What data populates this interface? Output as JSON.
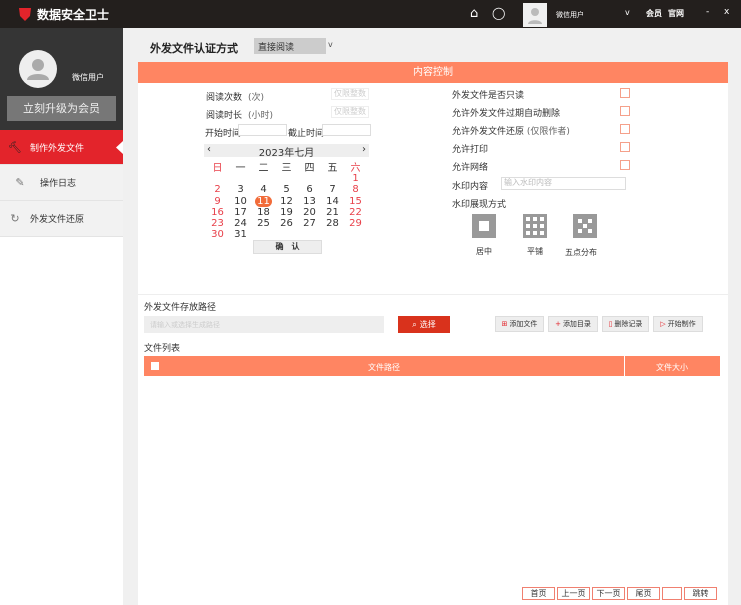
{
  "app": {
    "title": "数据安全卫士",
    "user": "微信用户",
    "member": "会员",
    "site": "官网",
    "minimize": "-",
    "close": "x",
    "dropdown": "v"
  },
  "sidebar": {
    "user": "微信用户",
    "upgrade": "立刻升级为会员",
    "items": [
      {
        "label": "制作外发文件",
        "icon": "wrench-icon"
      },
      {
        "label": "操作日志",
        "icon": "edit-icon"
      },
      {
        "label": "外发文件还原",
        "icon": "refresh-icon"
      }
    ]
  },
  "auth": {
    "label": "外发文件认证方式",
    "value": "直接阅读",
    "arrow": "v"
  },
  "content_control": {
    "title": "内容控制",
    "read_count": {
      "label": "阅读次数",
      "unit": "(次)",
      "placeholder": "仅限整数"
    },
    "read_duration": {
      "label": "阅读时长",
      "unit": "(小时)",
      "placeholder": "仅限整数"
    },
    "start_time": "开始时间",
    "end_time": "截止时间",
    "calendar": {
      "title": "2023年七月",
      "prev": "‹",
      "next": "›",
      "weekdays": [
        "日",
        "一",
        "二",
        "三",
        "四",
        "五",
        "六"
      ],
      "first_weekday": 6,
      "days": 31,
      "selected": 11,
      "confirm": "确　认"
    },
    "options": [
      {
        "label": "外发文件是否只读",
        "checked": false
      },
      {
        "label": "允许外发文件过期自动删除",
        "checked": false
      },
      {
        "label": "允许外发文件还原",
        "note": "(仅限作者)",
        "checked": false
      },
      {
        "label": "允许打印",
        "checked": false
      },
      {
        "label": "允许网络",
        "checked": false
      }
    ],
    "watermark": {
      "label": "水印内容",
      "placeholder": "输入水印内容",
      "mode_label": "水印展现方式",
      "modes": [
        "居中",
        "平铺",
        "五点分布"
      ]
    }
  },
  "path": {
    "label": "外发文件存放路径",
    "placeholder": "请输入或选择生成路径",
    "select": "选择"
  },
  "toolbar": {
    "add_file": "添加文件",
    "add_dir": "添加目录",
    "delete": "删除记录",
    "start": "开始制作"
  },
  "file_list": {
    "label": "文件列表",
    "columns": [
      "文件路径",
      "文件大小"
    ],
    "rows": []
  },
  "pager": {
    "first": "首页",
    "prev": "上一页",
    "next": "下一页",
    "last": "尾页",
    "page": "",
    "go": "跳转"
  },
  "colors": {
    "accent": "#ff8562",
    "red": "#e3242b",
    "dark": "#231f1d"
  }
}
